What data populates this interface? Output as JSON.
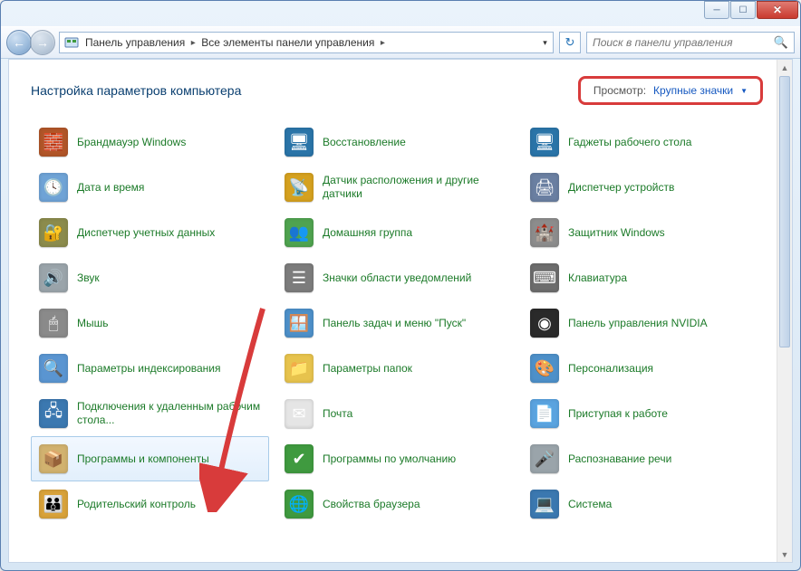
{
  "breadcrumb": {
    "root": "Панель управления",
    "child": "Все элементы панели управления"
  },
  "search": {
    "placeholder": "Поиск в панели управления"
  },
  "page": {
    "title": "Настройка параметров компьютера",
    "view_label": "Просмотр:",
    "view_value": "Крупные значки"
  },
  "items": [
    {
      "label": "Брандмауэр Windows",
      "icon": "shield-icon",
      "color": "#b15528",
      "glyph": "🧱"
    },
    {
      "label": "Восстановление",
      "icon": "restore-icon",
      "color": "#2a74a8",
      "glyph": "🖥"
    },
    {
      "label": "Гаджеты рабочего стола",
      "icon": "gadget-icon",
      "color": "#2a74a8",
      "glyph": "🖥"
    },
    {
      "label": "Дата и время",
      "icon": "clock-icon",
      "color": "#6fa3d6",
      "glyph": "🕓"
    },
    {
      "label": "Датчик расположения и другие датчики",
      "icon": "sensor-icon",
      "color": "#d5a11f",
      "glyph": "📡"
    },
    {
      "label": "Диспетчер устройств",
      "icon": "device-icon",
      "color": "#6a7fa1",
      "glyph": "🖨"
    },
    {
      "label": "Диспетчер учетных данных",
      "icon": "vault-icon",
      "color": "#8b8b4c",
      "glyph": "🔐"
    },
    {
      "label": "Домашняя группа",
      "icon": "homegroup-icon",
      "color": "#4fa34f",
      "glyph": "👥"
    },
    {
      "label": "Защитник Windows",
      "icon": "defender-icon",
      "color": "#8c8c8c",
      "glyph": "🏰"
    },
    {
      "label": "Звук",
      "icon": "sound-icon",
      "color": "#9aa4aa",
      "glyph": "🔊"
    },
    {
      "label": "Значки области уведомлений",
      "icon": "tray-icon",
      "color": "#7c7c7c",
      "glyph": "☰"
    },
    {
      "label": "Клавиатура",
      "icon": "keyboard-icon",
      "color": "#6d6d6d",
      "glyph": "⌨"
    },
    {
      "label": "Мышь",
      "icon": "mouse-icon",
      "color": "#8a8a8a",
      "glyph": "🖱"
    },
    {
      "label": "Панель задач и меню \"Пуск\"",
      "icon": "taskbar-icon",
      "color": "#4d90c9",
      "glyph": "🪟"
    },
    {
      "label": "Панель управления NVIDIA",
      "icon": "nvidia-icon",
      "color": "#2a2a2a",
      "glyph": "◉"
    },
    {
      "label": "Параметры индексирования",
      "icon": "index-icon",
      "color": "#5a95d1",
      "glyph": "🔍"
    },
    {
      "label": "Параметры папок",
      "icon": "folder-icon",
      "color": "#e7c34d",
      "glyph": "📁"
    },
    {
      "label": "Персонализация",
      "icon": "theme-icon",
      "color": "#4d90c9",
      "glyph": "🎨"
    },
    {
      "label": "Подключения к удаленным рабочим стола...",
      "icon": "remote-icon",
      "color": "#3b78b0",
      "glyph": "🖧"
    },
    {
      "label": "Почта",
      "icon": "mail-icon",
      "color": "#e5e5e5",
      "glyph": "✉"
    },
    {
      "label": "Приступая к работе",
      "icon": "getstarted-icon",
      "color": "#5aa3df",
      "glyph": "📄"
    },
    {
      "label": "Программы и компоненты",
      "icon": "programs-icon",
      "color": "#d1b26f",
      "glyph": "📦",
      "highlight": true
    },
    {
      "label": "Программы по умолчанию",
      "icon": "defaults-icon",
      "color": "#3f9a3f",
      "glyph": "✔"
    },
    {
      "label": "Распознавание речи",
      "icon": "speech-icon",
      "color": "#9aa4aa",
      "glyph": "🎤"
    },
    {
      "label": "Родительский контроль",
      "icon": "parental-icon",
      "color": "#d8a23a",
      "glyph": "👪"
    },
    {
      "label": "Свойства браузера",
      "icon": "internet-icon",
      "color": "#3f9a3f",
      "glyph": "🌐"
    },
    {
      "label": "Система",
      "icon": "system-icon",
      "color": "#3b78b0",
      "glyph": "💻"
    }
  ]
}
